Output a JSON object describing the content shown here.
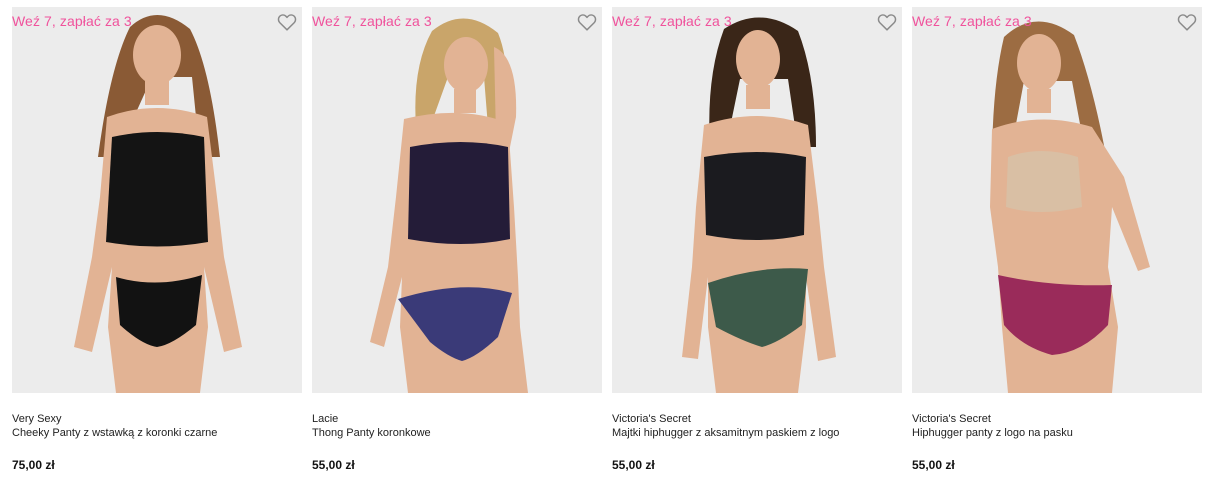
{
  "products": [
    {
      "promo": "Weź 7, zapłać za 3",
      "brand": "Very Sexy",
      "name": "Cheeky Panty z wstawką z koronki czarne",
      "price": "75,00 zł",
      "top_color": "#141414",
      "bottom_color": "#121212",
      "hair_color": "#8a5a35"
    },
    {
      "promo": "Weź 7, zapłać za 3",
      "brand": "Lacie",
      "name": "Thong Panty koronkowe",
      "price": "55,00 zł",
      "top_color": "#241c38",
      "bottom_color": "#3a3a78",
      "hair_color": "#c9a56a"
    },
    {
      "promo": "Weź 7, zapłać za 3",
      "brand": "Victoria's Secret",
      "name": "Majtki hiphugger z aksamitnym paskiem z logo",
      "price": "55,00 zł",
      "top_color": "#1b1b1f",
      "bottom_color": "#3d5a4a",
      "hair_color": "#3a2618"
    },
    {
      "promo": "Weź 7, zapłać za 3",
      "brand": "Victoria's Secret",
      "name": "Hiphugger panty z logo na pasku",
      "price": "55,00 zł",
      "top_color": "#d9bfa4",
      "bottom_color": "#9a2b5a",
      "hair_color": "#9c6c42"
    }
  ],
  "colors": {
    "promo": "#f0529c",
    "image_bg": "#ececec",
    "skin": "#e2b394"
  },
  "icons": {
    "favorite": "heart-outline-icon"
  }
}
